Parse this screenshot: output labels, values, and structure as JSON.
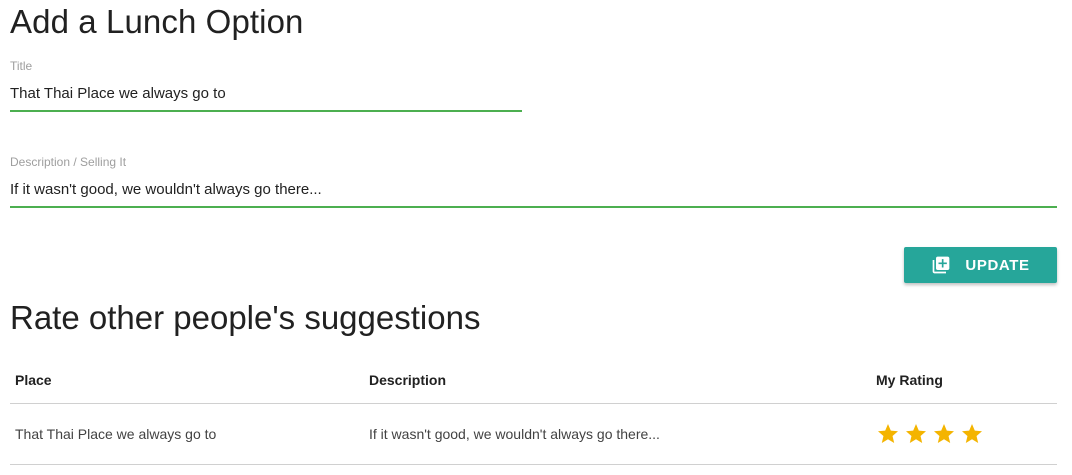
{
  "form": {
    "heading": "Add a Lunch Option",
    "title_label": "Title",
    "title_value": "That Thai Place we always go to",
    "description_label": "Description / Selling It",
    "description_value": "If it wasn't good, we wouldn't always go there...",
    "update_label": "UPDATE",
    "accent_color": "#4caf50",
    "button_color": "#26a69a"
  },
  "ratings": {
    "heading": "Rate other people's suggestions",
    "columns": {
      "place": "Place",
      "description": "Description",
      "rating": "My Rating"
    },
    "rows": [
      {
        "place": "That Thai Place we always go to",
        "description": "If it wasn't good, we wouldn't always go there...",
        "stars": 4,
        "star_icon": "star-icon",
        "star_color": "#f4b400"
      }
    ]
  }
}
